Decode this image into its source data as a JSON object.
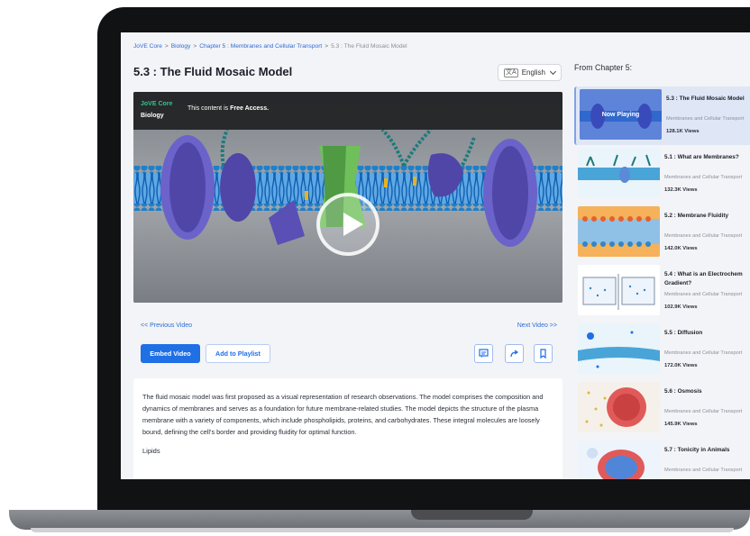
{
  "breadcrumb": {
    "items": [
      "JoVE Core",
      "Biology",
      "Chapter 5 : Membranes and Cellular Transport"
    ],
    "current": "5.3 : The Fluid Mosaic Model",
    "separator": ">"
  },
  "page_title": "5.3 : The Fluid Mosaic Model",
  "language": {
    "selected": "English",
    "icon": "translate-icon"
  },
  "video": {
    "brand": "JoVE Core",
    "subject": "Biology",
    "access_prefix": "This content is",
    "access_bold": "Free Access."
  },
  "navigation": {
    "prev": "<< Previous Video",
    "next": "Next Video >>"
  },
  "actions": {
    "embed": "Embed Video",
    "playlist": "Add to Playlist",
    "icons": [
      "transcript-icon",
      "share-icon",
      "bookmark-icon"
    ]
  },
  "description": {
    "paragraph": "The fluid mosaic model was first proposed as a visual representation of research observations. The model comprises the composition and dynamics of membranes and serves as a foundation for future membrane-related studies. The model depicts the structure of the plasma membrane with a variety of components, which include phospholipids, proteins, and carbohydrates. These integral molecules are loosely bound, defining the cell's border and providing fluidity for optimal function.",
    "heading": "Lipids"
  },
  "sidebar": {
    "title": "From Chapter 5:",
    "now_playing": "Now Playing",
    "items": [
      {
        "title": "5.3 : The Fluid Mosaic Model",
        "subtitle": "Membranes and Cellular Transport",
        "views": "128.1K Views"
      },
      {
        "title": "5.1 : What are Membranes?",
        "subtitle": "Membranes and Cellular Transport",
        "views": "132.3K Views"
      },
      {
        "title": "5.2 : Membrane Fluidity",
        "subtitle": "Membranes and Cellular Transport",
        "views": "142.0K Views"
      },
      {
        "title": "5.4 : What is an Electrochem Gradient?",
        "subtitle": "Membranes and Cellular Transport",
        "views": "102.9K Views"
      },
      {
        "title": "5.5 : Diffusion",
        "subtitle": "Membranes and Cellular Transport",
        "views": "172.0K Views"
      },
      {
        "title": "5.6 : Osmosis",
        "subtitle": "Membranes and Cellular Transport",
        "views": "145.9K Views"
      },
      {
        "title": "5.7 : Tonicity in Animals",
        "subtitle": "Membranes and Cellular Transport",
        "views": ""
      }
    ]
  },
  "colors": {
    "link": "#2d6bd6",
    "primary": "#1f6fe5",
    "brand_green": "#33c48d",
    "active_row": "#dfe6f6"
  }
}
